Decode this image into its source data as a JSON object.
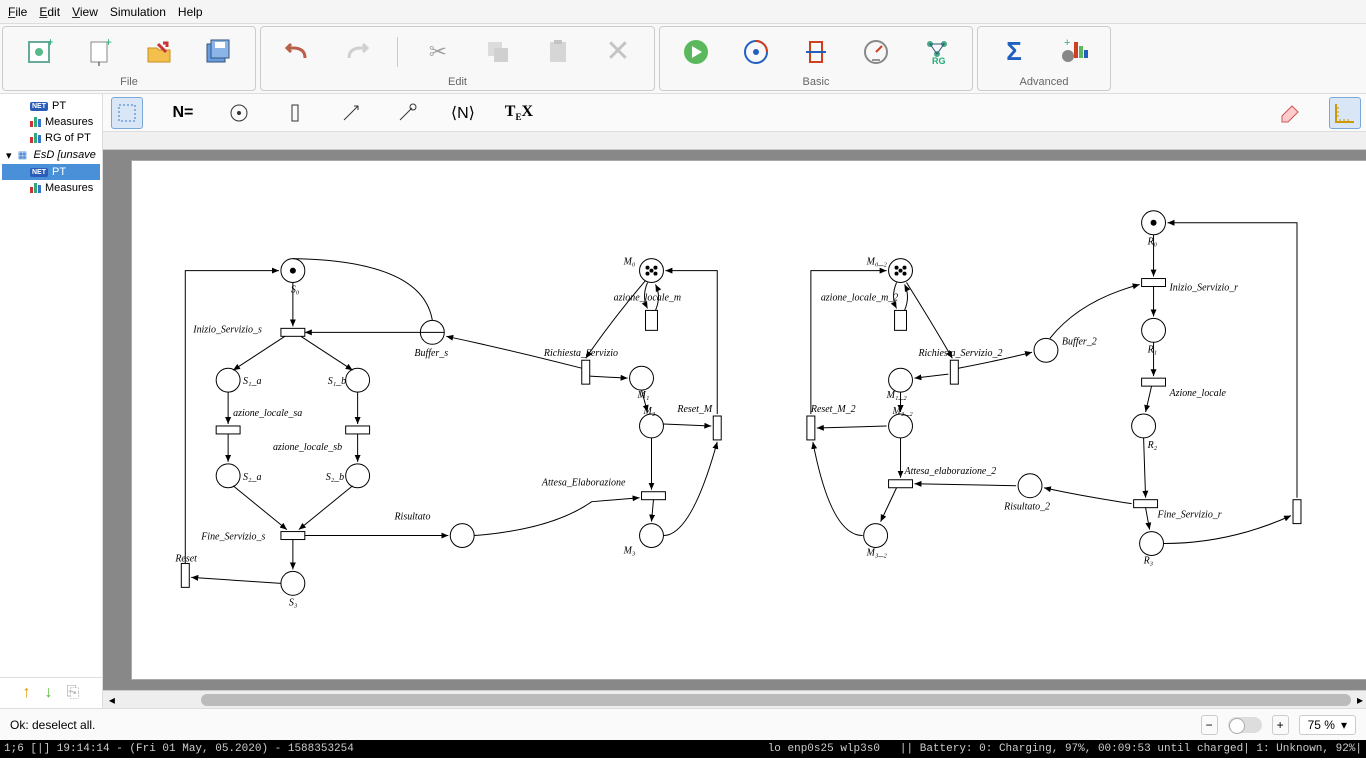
{
  "menubar": {
    "file": "File",
    "edit": "Edit",
    "view": "View",
    "simulation": "Simulation",
    "help": "Help"
  },
  "toolbar_groups": {
    "file": "File",
    "edit": "Edit",
    "basic": "Basic",
    "advanced": "Advanced"
  },
  "tree": {
    "pt": "PT",
    "measures": "Measures",
    "rg_of_pt": "RG of PT",
    "esd": "EsD [unsave",
    "pt2": "PT",
    "measures2": "Measures"
  },
  "toolbar2": {
    "neq": "N=",
    "angle_n": "⟨N⟩",
    "tex": "TEX"
  },
  "net": {
    "S0": "S₀",
    "Inizio_Servizio_s": "Inizio_Servizio_s",
    "S1_a": "S₁_a",
    "S1_b": "S₁_b",
    "azione_locale_sa": "azione_locale_sa",
    "azione_locale_sb": "azione_locale_sb",
    "S2_a": "S₂_a",
    "S2_b": "S₂_b",
    "Fine_Servizio_s": "Fine_Servizio_s",
    "S3": "S₃",
    "Reset": "Reset",
    "Buffer_s": "Buffer_s",
    "Risultato": "Risultato",
    "M0": "M₀",
    "azione_locale_m": "azione_locale_m",
    "Richiesta_Servizio": "Richiesta_Servizio",
    "M1": "M₁",
    "M2": "M₂",
    "M3": "M₃",
    "Reset_M": "Reset_M",
    "Attesa_Elaborazione": "Attesa_Elaborazione",
    "M0_2": "M₀_₂",
    "azione_locale_m_2": "azione_locale_m_2",
    "Richiesta_Servizio_2": "Richiesta_Servizio_2",
    "M1_2": "M₁_₂",
    "M2_2": "M₂_₂",
    "M3_2": "M₃_₂",
    "Reset_M_2": "Reset_M_2",
    "Attesa_elaborazione_2": "Attesa_elaborazione_2",
    "Risultato_2": "Risultato_2",
    "Buffer_2": "Buffer_2",
    "R0": "R₀",
    "R1": "R₁",
    "R2": "R₂",
    "R3": "R₃",
    "Inizio_Servizio_r": "Inizio_Servizio_r",
    "Azione_locale": "Azione_locale",
    "Fine_Servizio_r": "Fine_Servizio_r"
  },
  "status": {
    "msg": "Ok: deselect all.",
    "zoom": "75 %"
  },
  "sysbar": {
    "left": "1;6 [|]   19:14:14 - (Fri 01 May, 05.2020) - 1588353254",
    "mid": "lo enp0s25 wlp3s0",
    "right": "||  Battery: 0: Charging, 97%, 00:09:53 until charged| 1: Unknown, 92%|"
  }
}
